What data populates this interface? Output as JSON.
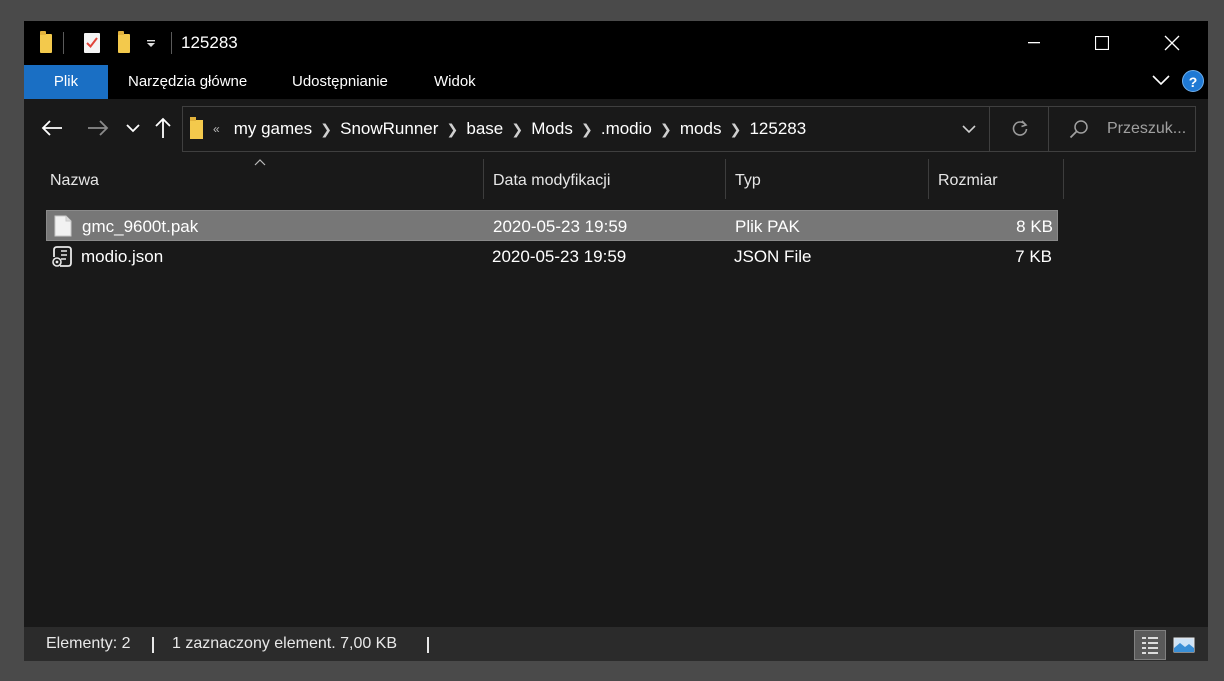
{
  "window": {
    "title": "125283",
    "minimize_label": "Minimize",
    "maximize_label": "Maximize",
    "close_label": "Close"
  },
  "ribbon": {
    "tabs": [
      {
        "label": "Plik"
      },
      {
        "label": "Narzędzia główne"
      },
      {
        "label": "Udostępnianie"
      },
      {
        "label": "Widok"
      }
    ]
  },
  "help_label": "?",
  "address": {
    "overflow": "«",
    "crumbs": [
      "my games",
      "SnowRunner",
      "base",
      "Mods",
      ".modio",
      "mods",
      "125283"
    ]
  },
  "search": {
    "placeholder": "Przeszuk..."
  },
  "columns": [
    "Nazwa",
    "Data modyfikacji",
    "Typ",
    "Rozmiar"
  ],
  "files": [
    {
      "name": "gmc_9600t.pak",
      "modified": "2020-05-23 19:59",
      "type": "Plik PAK",
      "size": "8 KB",
      "selected": true,
      "icon": "file-icon"
    },
    {
      "name": "modio.json",
      "modified": "2020-05-23 19:59",
      "type": "JSON File",
      "size": "7 KB",
      "selected": false,
      "icon": "json-file-icon"
    }
  ],
  "status": {
    "count": "Elementy: 2",
    "selection": "1 zaznaczony element. 7,00 KB"
  },
  "colors": {
    "accent": "#1a6fc4",
    "folder": "#f3c94c",
    "selection": "#777777"
  }
}
